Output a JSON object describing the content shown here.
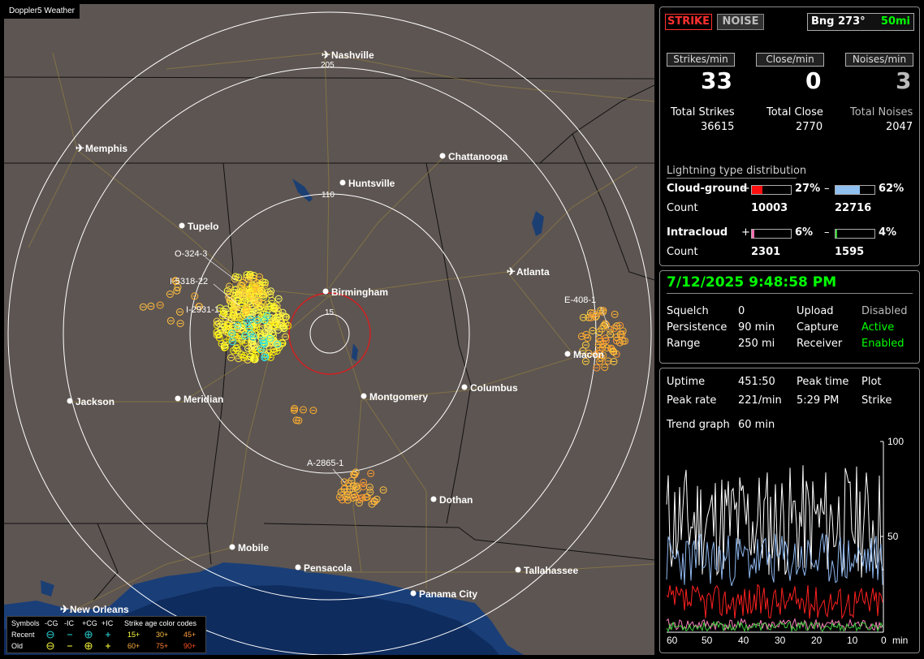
{
  "app_title": "Doppler5 Weather",
  "map": {
    "ring_labels": [
      "205",
      "110",
      "15"
    ],
    "cities": [
      {
        "name": "Nashville",
        "airport": true
      },
      {
        "name": "Memphis",
        "airport": true
      },
      {
        "name": "Chattanooga",
        "airport": false
      },
      {
        "name": "Huntsville",
        "airport": false
      },
      {
        "name": "Tupelo",
        "airport": false
      },
      {
        "name": "Birmingham",
        "airport": false
      },
      {
        "name": "Atlanta",
        "airport": true
      },
      {
        "name": "Macon",
        "airport": false
      },
      {
        "name": "Jackson",
        "airport": false
      },
      {
        "name": "Meridian",
        "airport": false
      },
      {
        "name": "Montgomery",
        "airport": false
      },
      {
        "name": "Columbus",
        "airport": false
      },
      {
        "name": "Dothan",
        "airport": false
      },
      {
        "name": "Mobile",
        "airport": false
      },
      {
        "name": "Pensacola",
        "airport": false
      },
      {
        "name": "Tallahassee",
        "airport": false
      },
      {
        "name": "Panama City",
        "airport": false
      },
      {
        "name": "New Orleans",
        "airport": true
      }
    ],
    "storm_labels": [
      "O-324-3",
      "I-5318-22",
      "I-2931-1",
      "E-408-1",
      "A-2865-1"
    ],
    "legend": {
      "symbols_label": "Symbols",
      "types": [
        "-CG",
        "-IC",
        "+CG",
        "+IC"
      ],
      "age_label": "Strike age color codes",
      "recent_label": "Recent",
      "old_label": "Old",
      "recent_ages": [
        "15+",
        "30+",
        "45+"
      ],
      "old_ages": [
        "60+",
        "75+",
        "90+"
      ]
    }
  },
  "top_panel": {
    "strike_button": "STRIKE",
    "noise_button": "NOISE",
    "bearing": "Bng 273°",
    "range": "50mi",
    "headers": [
      "Strikes/min",
      "Close/min",
      "Noises/min"
    ],
    "rates": [
      "33",
      "0",
      "3"
    ],
    "total_labels": [
      "Total Strikes",
      "Total Close",
      "Total Noises"
    ],
    "totals": [
      "36615",
      "2770",
      "2047"
    ],
    "dist_title": "Lightning type distribution",
    "cg_label": "Cloud-ground",
    "cg_pos_pct": "27%",
    "cg_neg_pct": "62%",
    "cg_pos_fraction": 0.27,
    "cg_neg_fraction": 0.62,
    "count_label": "Count",
    "cg_pos_count": "10003",
    "cg_neg_count": "22716",
    "ic_label": "Intracloud",
    "ic_pos_pct": "6%",
    "ic_neg_pct": "4%",
    "ic_pos_fraction": 0.06,
    "ic_neg_fraction": 0.04,
    "ic_pos_count": "2301",
    "ic_neg_count": "1595",
    "plus": "+",
    "minus": "–"
  },
  "status_panel": {
    "datetime": "7/12/2025 9:48:58 PM",
    "squelch_label": "Squelch",
    "squelch": "0",
    "persistence_label": "Persistence",
    "persistence": "90 min",
    "range_label": "Range",
    "range": "250 mi",
    "upload_label": "Upload",
    "upload": "Disabled",
    "capture_label": "Capture",
    "capture": "Active",
    "receiver_label": "Receiver",
    "receiver": "Enabled"
  },
  "trend_panel": {
    "uptime_label": "Uptime",
    "uptime": "451:50",
    "peak_time_label": "Peak time",
    "plot_label": "Plot",
    "peak_rate_label": "Peak rate",
    "peak_rate": "221/min",
    "peak_time": "5:29 PM",
    "plot": "Strike",
    "trend_label": "Trend graph",
    "trend_value": "60 min",
    "y_ticks": [
      "100",
      "50"
    ],
    "x_ticks": [
      "60",
      "50",
      "40",
      "30",
      "20",
      "10",
      "0"
    ],
    "x_unit": "min",
    "colors": {
      "total": "#ffffff",
      "cg_neg": "#8fb8f0",
      "cg_pos": "#ff2020",
      "ic_pos": "#ff80c0",
      "ic_neg": "#40d040"
    }
  }
}
